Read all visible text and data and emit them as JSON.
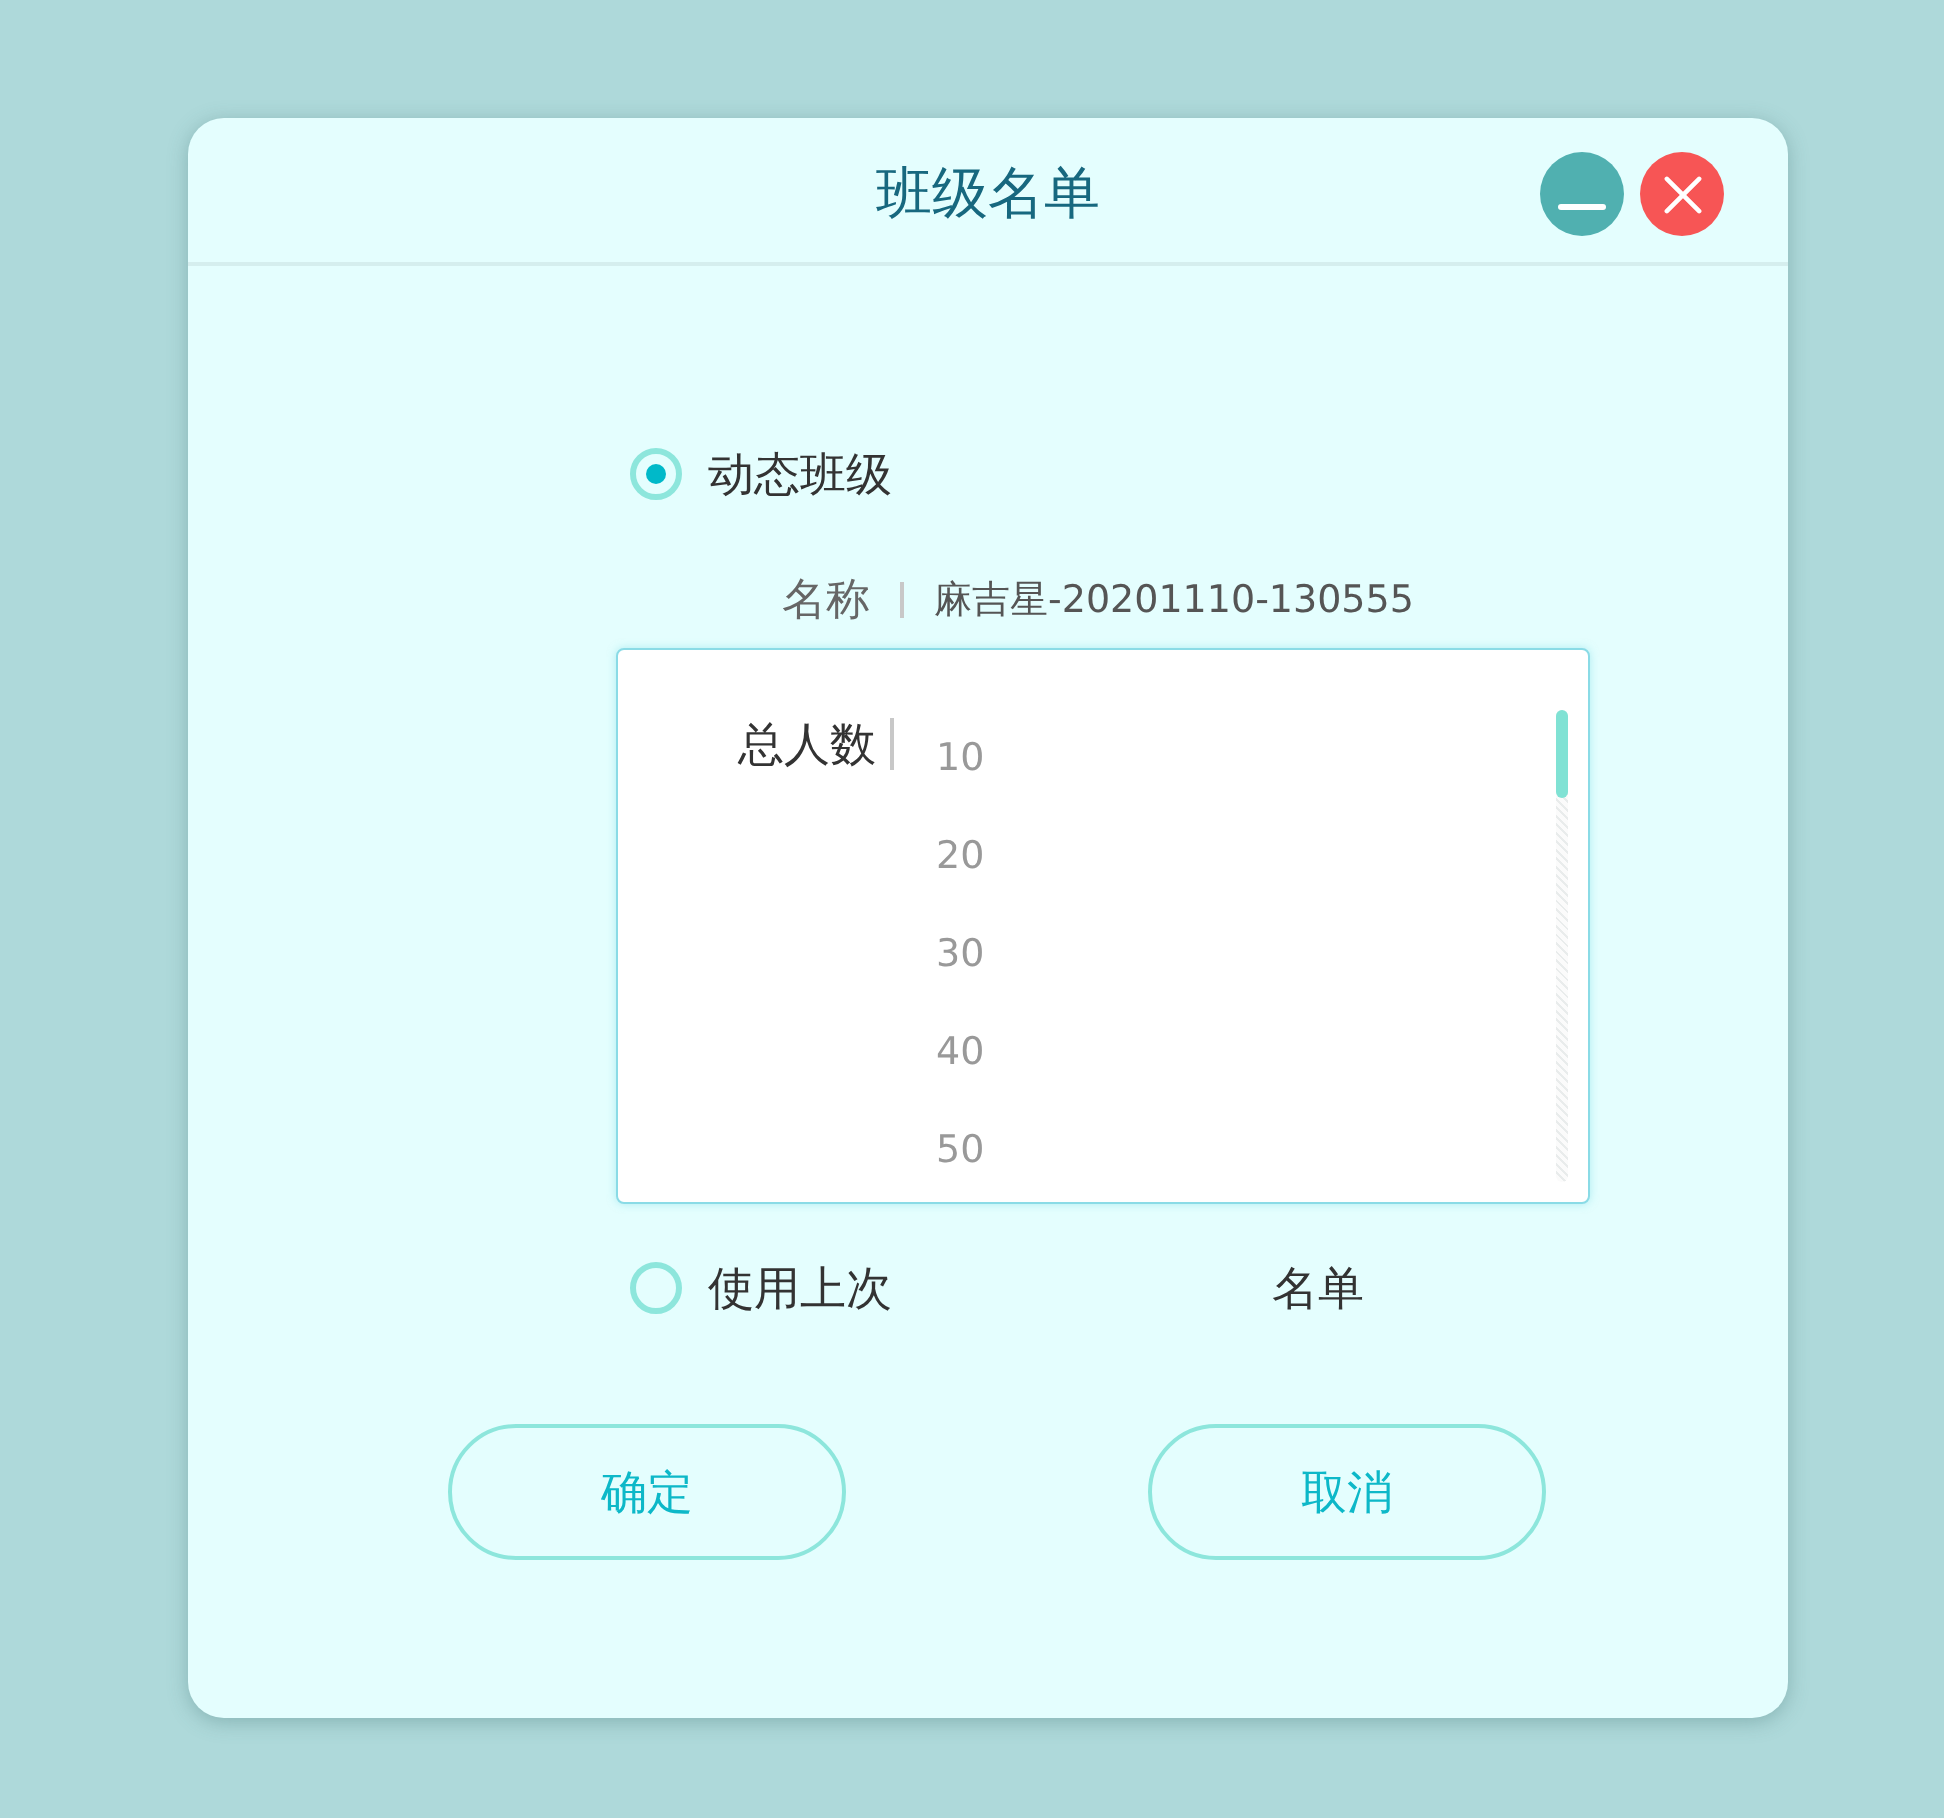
{
  "window": {
    "title": "班级名单",
    "controls": [
      {
        "kind": "minimize"
      },
      {
        "kind": "close"
      }
    ]
  },
  "dynamic_option": {
    "label": "动态班级",
    "selected": true
  },
  "name_field": {
    "label": "名称",
    "value": "麻吉星-20201110-130555"
  },
  "total_dropdown": {
    "label": "总人数",
    "options": [
      {
        "label": "10",
        "selected": false
      },
      {
        "label": "20",
        "selected": false
      },
      {
        "label": "30",
        "selected": false
      },
      {
        "label": "40",
        "selected": false
      },
      {
        "label": "50",
        "selected": false
      }
    ]
  },
  "last_option": {
    "label": "使用上次",
    "selected": false,
    "suffix": "名单"
  },
  "buttons": [
    "确定",
    "取消"
  ]
}
